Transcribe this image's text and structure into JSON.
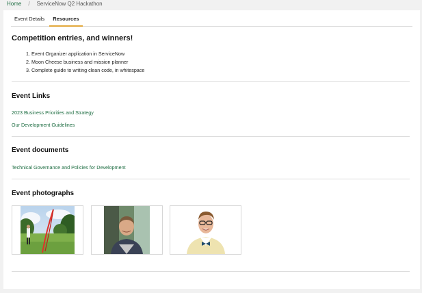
{
  "breadcrumb": {
    "home": "Home",
    "separator": "/",
    "current": "ServiceNow Q2 Hackathon"
  },
  "tabs": [
    {
      "label": "Event Details",
      "active": false
    },
    {
      "label": "Resources",
      "active": true
    }
  ],
  "competition": {
    "title": "Competition entries, and winners!",
    "entries": [
      "1. Event Organizer application in ServiceNow",
      "2. Moon Cheese business and mission planner",
      "3. Complete guide to writing clean code, in whitespace"
    ]
  },
  "event_links": {
    "title": "Event Links",
    "links": [
      "2023 Business Priorities and Strategy",
      "Our Development Guidelines"
    ]
  },
  "event_documents": {
    "title": "Event documents",
    "links": [
      "Technical Governance and Policies for Development"
    ]
  },
  "event_photographs": {
    "title": "Event photographs",
    "photos": [
      {
        "icon": "golf-course-photo"
      },
      {
        "icon": "man-portrait-photo"
      },
      {
        "icon": "man-bowtie-portrait-photo"
      }
    ]
  },
  "colors": {
    "link": "#1f6e43",
    "tab_underline": "#e2a83b"
  }
}
